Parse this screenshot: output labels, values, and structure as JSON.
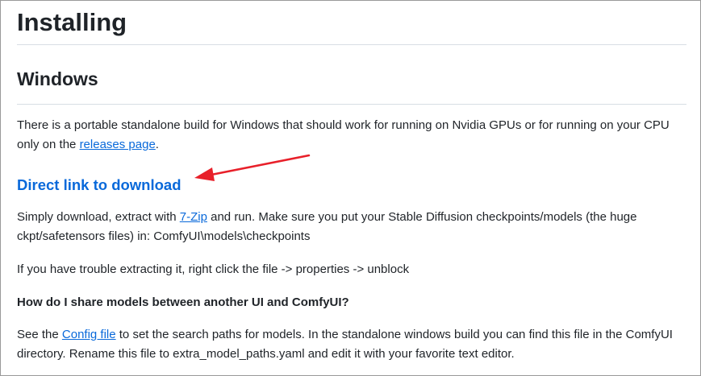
{
  "page": {
    "title": "Installing",
    "section_title": "Windows",
    "intro_text_1": "There is a portable standalone build for Windows that should work for running on Nvidia GPUs or for running on your CPU only on the ",
    "intro_link": "releases page",
    "intro_text_2": ".",
    "download_link": "Direct link to download",
    "download_text_1": "Simply download, extract with ",
    "download_link_7zip": "7-Zip",
    "download_text_2": " and run. Make sure you put your Stable Diffusion checkpoints/models (the huge ckpt/safetensors files) in: ComfyUI\\models\\checkpoints",
    "trouble_text": "If you have trouble extracting it, right click the file -> properties -> unblock",
    "faq_title": "How do I share models between another UI and ComfyUI?",
    "faq_text_1": "See the ",
    "faq_link": "Config file",
    "faq_text_2": " to set the search paths for models. In the standalone windows build you can find this file in the ComfyUI directory. Rename this file to extra_model_paths.yaml and edit it with your favorite text editor."
  },
  "colors": {
    "link": "#0969da",
    "text": "#1f2328",
    "divider": "#d8dee4",
    "annotation_arrow": "#e8202a"
  },
  "icons": {
    "annotation": "red-pointer-arrow-icon"
  }
}
